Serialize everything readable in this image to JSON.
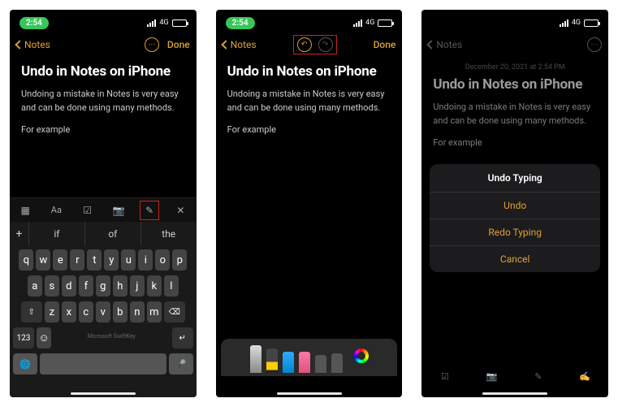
{
  "status": {
    "time": "2:54",
    "network": "4G"
  },
  "nav": {
    "back": "Notes",
    "done": "Done"
  },
  "note": {
    "title": "Undo in Notes on iPhone",
    "body": "Undoing a mistake in Notes is very easy and can be done using many methods.",
    "body2": "For example",
    "meta": "December 20, 2021 at 2:54 PM"
  },
  "predictions": {
    "p1": "if",
    "p2": "of",
    "p3": "the"
  },
  "keyboard": {
    "row1": [
      "q",
      "w",
      "e",
      "r",
      "t",
      "y",
      "u",
      "i",
      "o",
      "p"
    ],
    "row2": [
      "a",
      "s",
      "d",
      "f",
      "g",
      "h",
      "j",
      "k",
      "l"
    ],
    "row3": [
      "z",
      "x",
      "c",
      "v",
      "b",
      "n",
      "m"
    ],
    "shift": "⇧",
    "bksp": "⌫",
    "num": "123",
    "return": "↵",
    "branding": "Microsoft SwiftKey"
  },
  "sheet": {
    "title": "Undo Typing",
    "undo": "Undo",
    "redo": "Redo Typing",
    "cancel": "Cancel"
  }
}
